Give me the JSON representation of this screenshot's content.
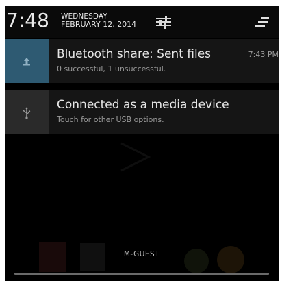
{
  "header": {
    "time": "7:48",
    "day_of_week": "WEDNESDAY",
    "date": "FEBRUARY 12, 2014",
    "settings_icon": "quick-settings-sliders-icon",
    "clear_icon": "clear-all-notifications-icon"
  },
  "notifications": [
    {
      "title": "Bluetooth share: Sent files",
      "subtitle": "0 successful, 1 unsuccessful.",
      "time": "7:43 PM",
      "icon": "upload-arrow-icon"
    },
    {
      "title": "Connected as a media device",
      "subtitle": "Touch for other USB options.",
      "icon": "usb-icon"
    }
  ],
  "footer": {
    "carrier": "M-GUEST"
  },
  "colors": {
    "shade_background": "#000000",
    "notification_background": "#151515",
    "bluetooth_icon_background": "#2e5a72",
    "usb_icon_background": "#2a2a2a",
    "primary_text": "#e6e6e6",
    "secondary_text": "#9a9a9a"
  }
}
